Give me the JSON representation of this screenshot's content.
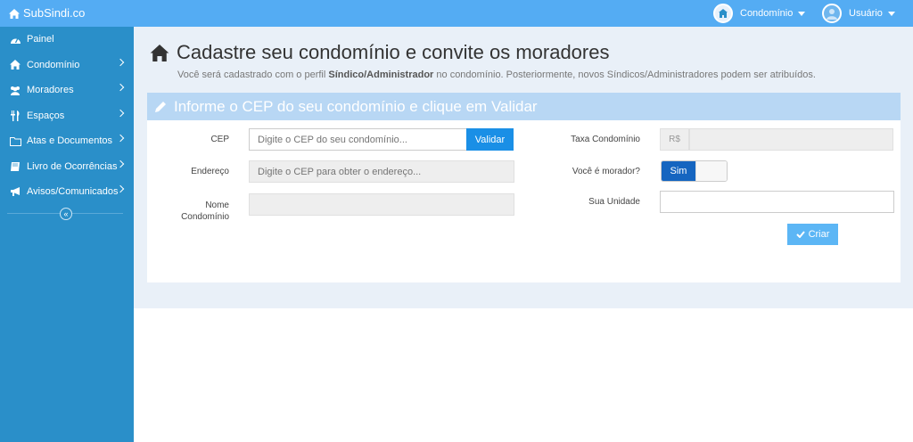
{
  "brand": {
    "name": "SubSindi.co"
  },
  "topbar": {
    "condominio_label": "Condomínio",
    "usuario_label": "Usuário"
  },
  "sidebar": {
    "items": [
      {
        "label": "Painel",
        "icon": "dashboard-icon",
        "has_submenu": false
      },
      {
        "label": "Condomínio",
        "icon": "home-icon",
        "has_submenu": true
      },
      {
        "label": "Moradores",
        "icon": "users-icon",
        "has_submenu": true
      },
      {
        "label": "Espaços",
        "icon": "cutlery-icon",
        "has_submenu": true
      },
      {
        "label": "Atas e Documentos",
        "icon": "folder-icon",
        "has_submenu": true
      },
      {
        "label": "Livro de Ocorrências",
        "icon": "book-icon",
        "has_submenu": true
      },
      {
        "label": "Avisos/Comunicados",
        "icon": "bullhorn-icon",
        "has_submenu": true
      }
    ],
    "collapse_glyph": "«"
  },
  "page": {
    "title": "Cadastre seu condomínio e convite os moradores",
    "subtitle_prefix": "Você será cadastrado com o perfil ",
    "subtitle_bold": "Síndico/Administrador",
    "subtitle_suffix": " no condomínio. Posteriormente, novos Síndicos/Administradores podem ser atribuídos."
  },
  "form": {
    "heading": "Informe o CEP do seu condomínio e clique em Validar",
    "cep_label": "CEP",
    "cep_placeholder": "Digite o CEP do seu condomínio...",
    "cep_value": "",
    "validar_label": "Validar",
    "endereco_label": "Endereço",
    "endereco_placeholder": "Digite o CEP para obter o endereço...",
    "nome_label": "Nome Condomínio",
    "nome_value": "",
    "taxa_label": "Taxa Condomínio",
    "taxa_addon": "R$",
    "taxa_value": "",
    "morador_label": "Você é morador?",
    "morador_value": "Sim",
    "unidade_label": "Sua Unidade",
    "unidade_value": "",
    "criar_label": "Criar"
  },
  "colors": {
    "topbar": "#54acf3",
    "sidebar": "#2a8fc9",
    "panel_header": "#b8d7f4",
    "primary_button": "#1a8fe6",
    "toggle_on": "#1565c0"
  }
}
